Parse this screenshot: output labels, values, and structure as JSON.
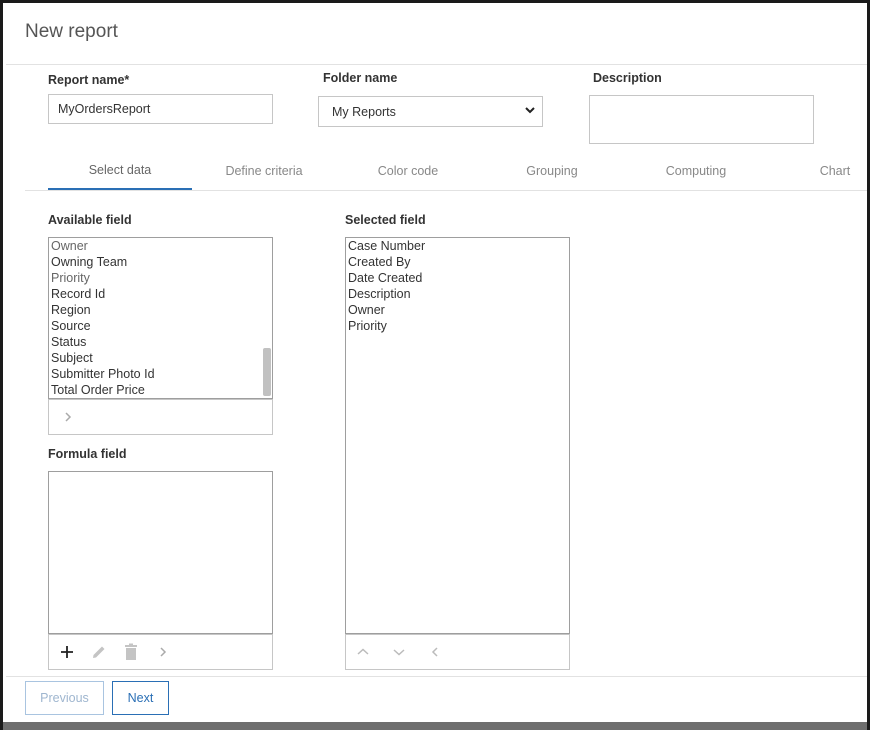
{
  "dialog": {
    "title": "New report"
  },
  "form": {
    "report_name_label": "Report name*",
    "report_name_value": "MyOrdersReport",
    "folder_name_label": "Folder name",
    "folder_name_value": "My Reports",
    "description_label": "Description",
    "description_value": ""
  },
  "tabs": [
    {
      "label": "Select data",
      "active": true
    },
    {
      "label": "Define criteria",
      "active": false
    },
    {
      "label": "Color code",
      "active": false
    },
    {
      "label": "Grouping",
      "active": false
    },
    {
      "label": "Computing",
      "active": false
    },
    {
      "label": "Chart",
      "active": false
    }
  ],
  "available": {
    "label": "Available field",
    "items": [
      "Owner",
      "Owning Team",
      "Priority",
      "Record Id",
      "Region",
      "Source",
      "Status",
      "Subject",
      "Submitter Photo Id",
      "Total Order Price"
    ]
  },
  "selected": {
    "label": "Selected field",
    "items": [
      "Case Number",
      "Created By",
      "Date Created",
      "Description",
      "Owner",
      "Priority"
    ]
  },
  "formula": {
    "label": "Formula field"
  },
  "icons": {
    "add_to_selected": "chevron-right-icon",
    "formula_add": "plus-icon",
    "formula_edit": "pencil-icon",
    "formula_delete": "trash-icon",
    "formula_move": "chevron-right-icon",
    "selected_up": "chevron-up-icon",
    "selected_down": "chevron-down-icon",
    "selected_remove": "chevron-left-icon"
  },
  "footer": {
    "previous_label": "Previous",
    "next_label": "Next"
  },
  "colors": {
    "accent": "#2a6fb5",
    "border": "#c6c6c6",
    "muted_text": "#888888"
  }
}
